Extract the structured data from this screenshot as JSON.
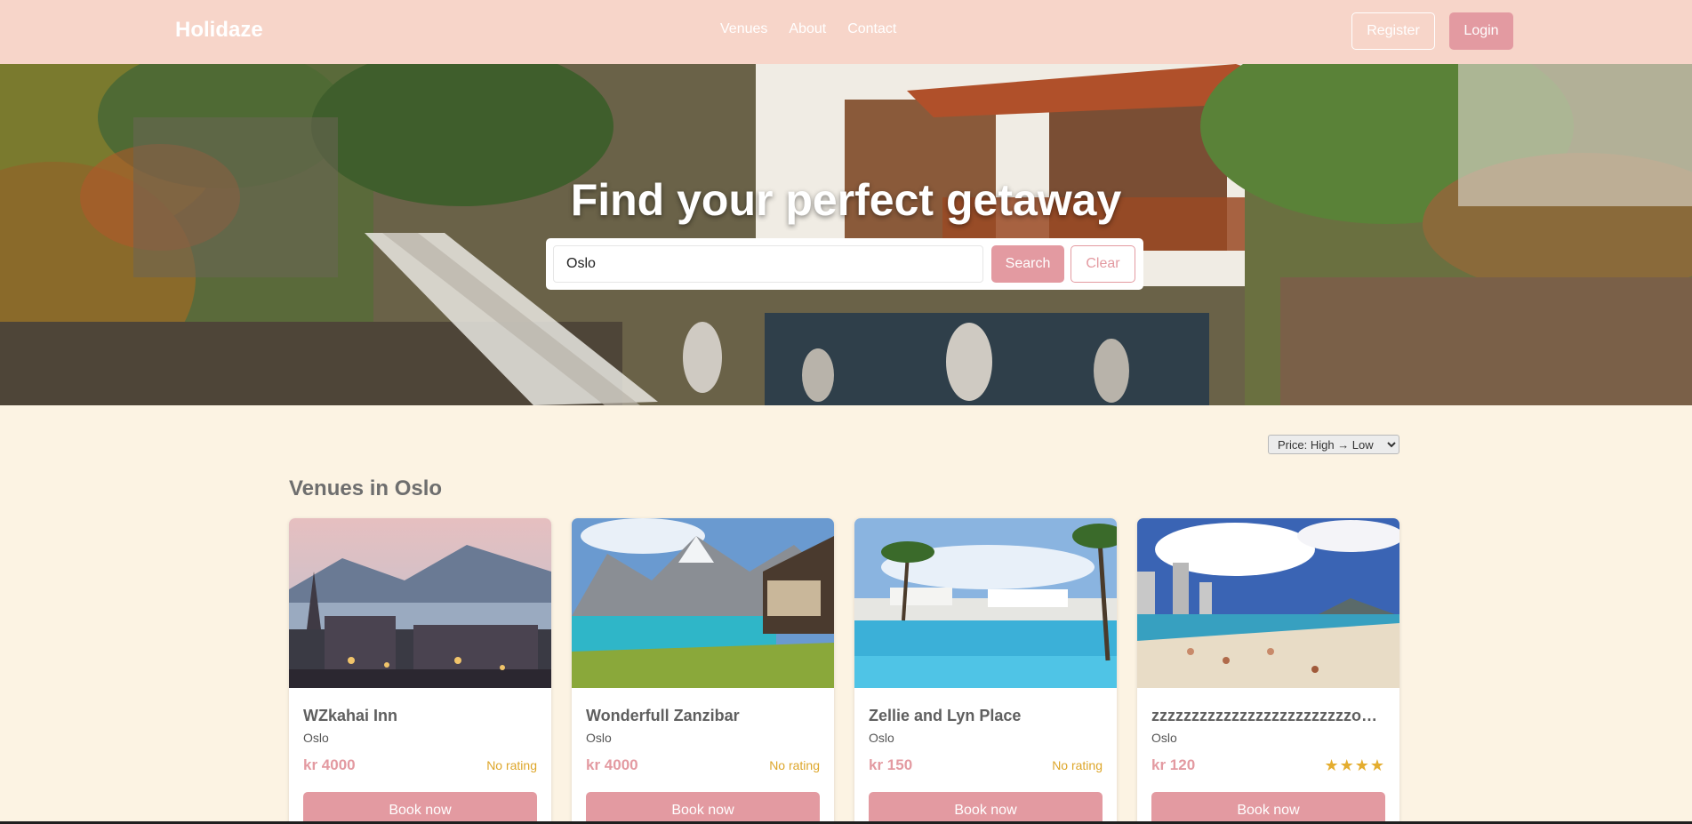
{
  "header": {
    "brand": "Holidaze",
    "nav": [
      "Venues",
      "About",
      "Contact"
    ],
    "register_label": "Register",
    "login_label": "Login"
  },
  "hero": {
    "title": "Find your perfect getaway",
    "search_value": "Oslo",
    "search_label": "Search",
    "clear_label": "Clear"
  },
  "sort": {
    "selected": "Price: High → Low"
  },
  "section_title": "Venues in Oslo",
  "venues": [
    {
      "name": "WZkahai Inn",
      "city": "Oslo",
      "price": "kr 4000",
      "rating": "No rating",
      "book_label": "Book now"
    },
    {
      "name": "Wonderfull Zanzibar",
      "city": "Oslo",
      "price": "kr 4000",
      "rating": "No rating",
      "book_label": "Book now"
    },
    {
      "name": "Zellie and Lyn Place",
      "city": "Oslo",
      "price": "kr 150",
      "rating": "No rating",
      "book_label": "Book now"
    },
    {
      "name": "zzzzzzzzzzzzzzzzzzzzzzzzzooo...",
      "city": "Oslo",
      "price": "kr 120",
      "rating": "★★★★",
      "book_label": "Book now"
    }
  ],
  "colors": {
    "navbar_bg": "#f7d5c9",
    "accent": "#e39aa1",
    "page_bg": "#fcf3e3",
    "rating_text": "#dda62a"
  }
}
